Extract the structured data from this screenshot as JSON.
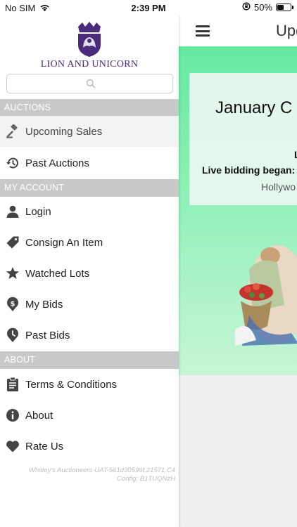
{
  "status_bar": {
    "carrier": "No SIM",
    "time": "2:39 PM",
    "battery_percent": "50%",
    "battery_level": 0.5
  },
  "main": {
    "title": "Upc",
    "card": {
      "title": "January C",
      "line1": "L",
      "line2": "Live bidding began: ",
      "line3": "Hollywo"
    }
  },
  "drawer": {
    "logo_text": "LION AND UNICORN",
    "search": {
      "placeholder": ""
    },
    "sections": [
      {
        "title": "AUCTIONS"
      },
      {
        "title": "MY ACCOUNT"
      },
      {
        "title": "ABOUT"
      }
    ],
    "auctions": [
      {
        "label": "Upcoming Sales",
        "icon": "gavel-icon",
        "active": true
      },
      {
        "label": "Past Auctions",
        "icon": "history-icon"
      }
    ],
    "account": [
      {
        "label": "Login",
        "icon": "user-icon"
      },
      {
        "label": "Consign An Item",
        "icon": "tag-icon"
      },
      {
        "label": "Watched Lots",
        "icon": "star-icon"
      },
      {
        "label": "My Bids",
        "icon": "dollar-pin-icon"
      },
      {
        "label": "Past Bids",
        "icon": "clock-pin-icon"
      }
    ],
    "about": [
      {
        "label": "Terms & Conditions",
        "icon": "clipboard-icon"
      },
      {
        "label": "About",
        "icon": "info-icon"
      },
      {
        "label": "Rate Us",
        "icon": "heart-icon"
      }
    ],
    "version_line1": "Whitley's Auctioneers-UAT-561d30599f.21571.C4",
    "version_line2": "Config: B1TUQNzH"
  },
  "colors": {
    "brand_purple": "#4a2a7a",
    "section_gray": "#c9c9c9",
    "hero_green": "#64eaa0"
  }
}
